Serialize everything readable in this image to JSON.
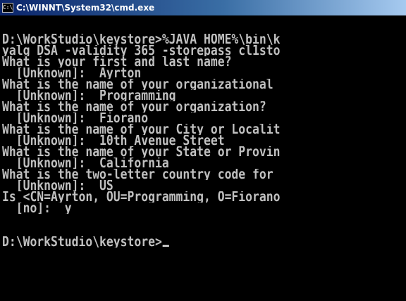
{
  "window": {
    "title": "C:\\WINNT\\System32\\cmd.exe",
    "icon": "cmd-icon"
  },
  "console": {
    "lines": [
      "",
      "D:\\WorkStudio\\keystore>%JAVA_HOME%\\bin\\k",
      "yalg DSA -validity 365 -storepass cl1sto",
      "What is your first and last name?",
      "  [Unknown]:  Ayrton",
      "What is the name of your organizational",
      "  [Unknown]:  Programming",
      "What is the name of your organization?",
      "  [Unknown]:  Fiorano",
      "What is the name of your City or Localit",
      "  [Unknown]:  10th Avenue Street",
      "What is the name of your State or Provin",
      "  [Unknown]:  California",
      "What is the two-letter country code for",
      "  [Unknown]:  US",
      "Is <CN=Ayrton, OU=Programming, O=Fiorano",
      "  [no]:  y",
      "",
      "",
      "D:\\WorkStudio\\keystore>"
    ]
  },
  "colors": {
    "background": "#000000",
    "text": "#c0c0c0",
    "titlebar_start": "#0a246a",
    "titlebar_end": "#a6caf0"
  }
}
